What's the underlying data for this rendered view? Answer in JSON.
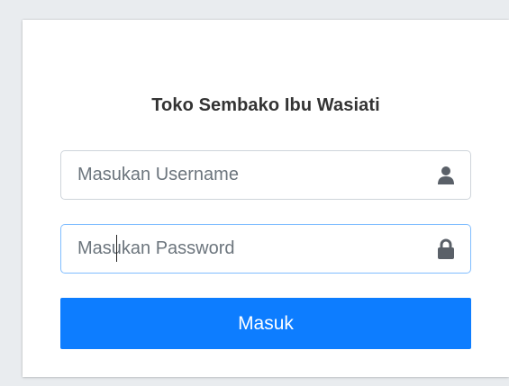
{
  "login": {
    "title": "Toko Sembako Ibu Wasiati",
    "username": {
      "placeholder": "Masukan Username",
      "value": "",
      "icon": "user-icon"
    },
    "password": {
      "placeholder": "Masukan Password",
      "value": "",
      "icon": "lock-icon"
    },
    "submit_label": "Masuk"
  },
  "colors": {
    "background": "#e9ecef",
    "primary_button": "#0d7dff",
    "focus_border": "#80bdff",
    "icon": "#5a6068"
  }
}
